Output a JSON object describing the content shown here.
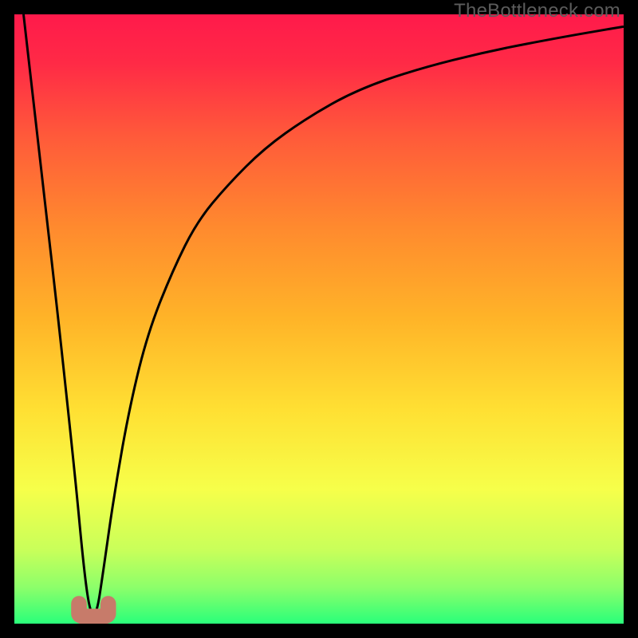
{
  "watermark": "TheBottleneck.com",
  "chart_data": {
    "type": "line",
    "title": "",
    "xlabel": "",
    "ylabel": "",
    "xlim": [
      0,
      100
    ],
    "ylim": [
      0,
      100
    ],
    "grid": false,
    "background_gradient_stops": [
      {
        "offset": 0.0,
        "color": "#ff1a4b"
      },
      {
        "offset": 0.08,
        "color": "#ff2a46"
      },
      {
        "offset": 0.2,
        "color": "#ff5a3a"
      },
      {
        "offset": 0.35,
        "color": "#ff8a2e"
      },
      {
        "offset": 0.5,
        "color": "#ffb428"
      },
      {
        "offset": 0.65,
        "color": "#ffe033"
      },
      {
        "offset": 0.78,
        "color": "#f6ff4a"
      },
      {
        "offset": 0.88,
        "color": "#c8ff5a"
      },
      {
        "offset": 0.94,
        "color": "#8dff6a"
      },
      {
        "offset": 1.0,
        "color": "#2aff7a"
      }
    ],
    "series": [
      {
        "name": "bottleneck-curve",
        "color": "#000000",
        "stroke_width": 3,
        "x": [
          1.5,
          4,
          7,
          10,
          11.5,
          12.5,
          13.5,
          14.5,
          16.5,
          19,
          22,
          26,
          30,
          35,
          41,
          48,
          56,
          66,
          78,
          90,
          100
        ],
        "y": [
          100,
          78,
          52,
          24,
          8,
          1.5,
          1.5,
          8,
          22,
          36,
          48,
          58,
          66,
          72,
          78,
          83,
          87.5,
          91,
          94,
          96.3,
          98
        ]
      }
    ],
    "marker": {
      "name": "valley-marker",
      "color": "#c77b6a",
      "cx": 13.0,
      "cy": 1.5,
      "rx": 3.0,
      "ry": 1.6
    }
  }
}
